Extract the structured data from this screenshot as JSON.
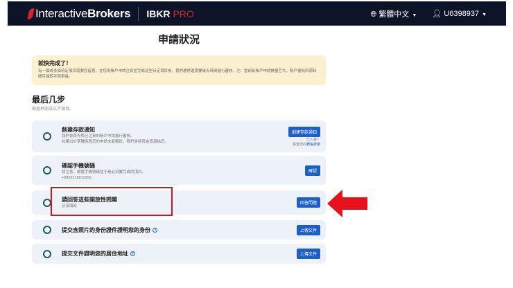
{
  "header": {
    "brand": "Interactive",
    "brand_bold": "Brokers",
    "product": "IBKR",
    "product_accent": "PRO",
    "language": "繁體中文",
    "user": "U6398937"
  },
  "page_title": "申請狀況",
  "banner": {
    "title": "就快完成了！",
    "text": "有一個或多個待定項目需要您留意。在您為賬戶申請注資並完成這些待定項目後，我們通常還需要幾天時間進行審核。注：當前新賬戶申請數量巨大，賬戶審批所需時間可能較平時更長。"
  },
  "section": {
    "title": "最后几步",
    "subtitle": "檢查并完成以下項目。"
  },
  "steps": [
    {
      "title": "創建存款通知",
      "lines": [
        "我們會首先對已注資的賬戶申請進行審核。",
        "如果出於某種原因您的申請未能獲批，我們會將資金退還給您。"
      ],
      "button": "創建存款通知",
      "note1": "已入金？",
      "note2_prefix": "檢查您的",
      "note2_link": "轉帳狀態"
    },
    {
      "title": "確認手機號碼",
      "lines": [
        "請注意，驗證手機號碼並不是必須要完成的項目。",
        "+8869216811000"
      ],
      "button": "確認"
    },
    {
      "title": "請回答這些開放性問題",
      "lines": [
        "必須填寫"
      ],
      "button": "回答問題"
    },
    {
      "title": "提交含照片的身份證件證明您的身份",
      "button": "上傳文件"
    },
    {
      "title": "提交文件證明您的居住地址",
      "button": "上傳文件"
    }
  ]
}
